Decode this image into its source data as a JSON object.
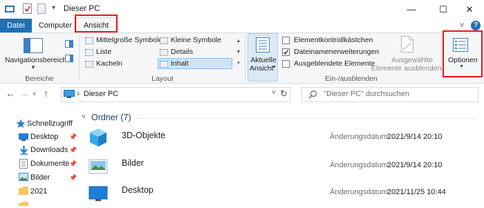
{
  "window": {
    "title": "Dieser PC",
    "controls": {
      "minimize": "—",
      "maximize": "☐",
      "close": "✕"
    }
  },
  "qat": {
    "dropdown_glyph": "▾"
  },
  "tabs": {
    "datei": "Datei",
    "computer": "Computer",
    "ansicht": "Ansicht",
    "help": "?",
    "collapse": "˅"
  },
  "ribbon": {
    "bereiche": {
      "nav_pane_label": "Navigationsbereich",
      "group_label": "Bereiche"
    },
    "layout": {
      "items": [
        "Mittelgroße Symbole",
        "Kleine Symbole",
        "Liste",
        "Details",
        "Kacheln",
        "Inhalt"
      ],
      "selected": "Inhalt",
      "group_label": "Layout"
    },
    "current_view": {
      "line1": "Aktuelle",
      "line2": "Ansicht"
    },
    "show_hide": {
      "checkboxes": [
        {
          "label": "Elementkontrollkästchen",
          "checked": false
        },
        {
          "label": "Dateinamenerweiterungen",
          "checked": true
        },
        {
          "label": "Ausgeblendete Elemente",
          "checked": false
        }
      ],
      "hide_selected": {
        "line1": "Ausgewählte",
        "line2": "Elemente ausblenden"
      },
      "group_label": "Ein-/ausblenden"
    },
    "options": {
      "label": "Optionen"
    }
  },
  "address": {
    "back": "←",
    "forward": "→",
    "recent": "˅",
    "up": "↑",
    "breadcrumb_sep": "›",
    "location": "Dieser PC",
    "dropdown": "˅",
    "refresh": "↻",
    "search_placeholder": "\"Dieser PC\" durchsuchen"
  },
  "navpane": {
    "quick_access": "Schnellzugriff",
    "items": [
      {
        "label": "Desktop",
        "pinned": true
      },
      {
        "label": "Downloads",
        "pinned": true
      },
      {
        "label": "Dokumente",
        "pinned": true
      },
      {
        "label": "Bilder",
        "pinned": true
      },
      {
        "label": "2021",
        "pinned": false
      }
    ]
  },
  "content": {
    "group_header": "Ordner (7)",
    "items": [
      {
        "name": "3D-Objekte",
        "date_label": "Änderungsdatum:",
        "date": "2021/9/14 20:10"
      },
      {
        "name": "Bilder",
        "date_label": "Änderungsdatum:",
        "date": "2021/9/14 20:10"
      },
      {
        "name": "Desktop",
        "date_label": "Änderungsdatum:",
        "date": "2021/11/25 10:44"
      }
    ]
  },
  "colors": {
    "accent": "#1f6fb5",
    "highlight_box": "#e8161b",
    "selected_bg": "#cde4f7",
    "group_header": "#1e3d7a"
  }
}
